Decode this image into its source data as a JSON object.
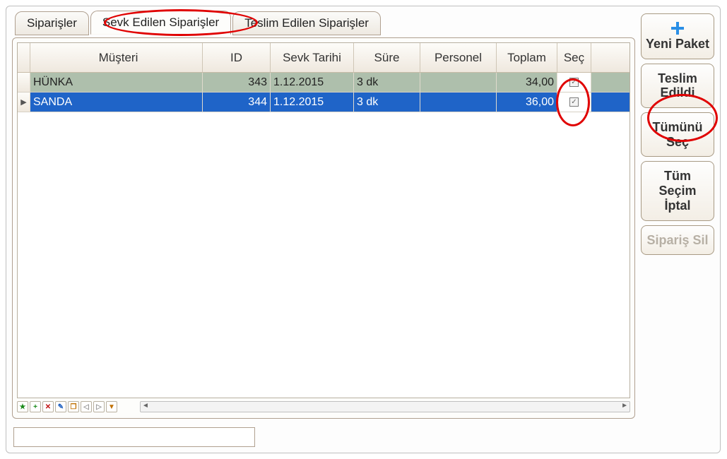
{
  "tabs": {
    "tab1": "Siparişler",
    "tab2": "Sevk Edilen Siparişler",
    "tab3": "Teslim Edilen Siparişler"
  },
  "columns": {
    "musteri": "Müşteri",
    "id": "ID",
    "tarih": "Sevk Tarihi",
    "sure": "Süre",
    "personel": "Personel",
    "toplam": "Toplam",
    "sec": "Seç"
  },
  "rows": [
    {
      "musteri": "HÜNKA",
      "id": "343",
      "tarih": "1.12.2015",
      "sure": "3 dk",
      "personel": "",
      "toplam": "34,00",
      "selected": false,
      "checked": true
    },
    {
      "musteri": "SANDA",
      "id": "344",
      "tarih": "1.12.2015",
      "sure": "3 dk",
      "personel": "",
      "toplam": "36,00",
      "selected": true,
      "checked": true
    }
  ],
  "buttons": {
    "yeni_paket": "Yeni Paket",
    "teslim_edildi": "Teslim Edildi",
    "tumunu_sec": "Tümünü Seç",
    "tum_secim_iptal": "Tüm Seçim İptal",
    "siparis_sil": "Sipariş Sil"
  },
  "footer_icons": {
    "star": "★",
    "plus": "+",
    "del": "✕",
    "edit": "✎",
    "copy": "❐",
    "prev": "◁",
    "next": "▷",
    "filter": "▼"
  }
}
